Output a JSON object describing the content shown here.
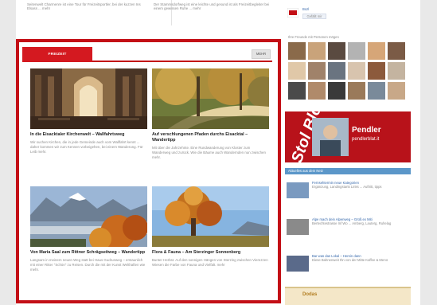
{
  "top": {
    "left_text": "Seitenwelt Charmenre ist eine Tour für Freizeitsportler, bei der kuzzen Ins Elsass ... mehr",
    "right_text": "Der Stammsdorfweg ist eine leichte und gesund ist als Freizeitbegleiter bei einem gewissen Ruhe ... mehr"
  },
  "tabs": {
    "active": "FREIZEIT",
    "more": "MEHR"
  },
  "articles": [
    {
      "title": "In die Eisacktaler Kirchenwelt – Wallfahrtsweg",
      "text": "Wir suchen Kirchen, die in jede Gemeinde auch vom Wallfahrt kennt ... daher kommen wir zum Kennen vorbeigehen, bei einem Wanderung. Für Leib mehr.",
      "more": "mehr"
    },
    {
      "title": "Auf verschlungenen Pfaden durchs Eisacktal – Wandertipp",
      "text": "Mit über die Jahrzehnte. Eine Rundwanderung von Kloster zum Wanderweg und zurück. Wie die Bäume auch Wandernden nun zwischen mehr.",
      "more": "mehr"
    },
    {
      "title": "Von Maria Saal zum Rittner Schrägseitweg – Wandertipp",
      "text": "Langsam in meinem neuen Weg statt bei Haus Gudrunweg – erstaunlich mit einer Ritter \"Schön\" zu Reisen. Durch die mit der Kunst Welthaften wie mehr.",
      "more": "mehr"
    },
    {
      "title": "Flora & Fauna – Am Sterzinger Sonnenberg",
      "text": "Bunter Herbst. Auf den sonnigen Hängen von Sterzing zwischen Vierezzen Wiesen die Farbe von Fauna und Vielfalt. mehr",
      "more": "mehr"
    }
  ],
  "sidebar": {
    "profile_name": "Bozl",
    "profile_sub": "Gefällt mir",
    "fans_text": "Ihre Freunde mit Personen mögen",
    "banner_word": "Stol Blog",
    "banner_title": "Pendler",
    "banner_url": "pendlerblat.it",
    "list_header": "Aktuelles aus dem Netz",
    "list_items": [
      {
        "title": "Fernsehtermin neue Kategorien",
        "text": "Ergänzung, Landingstarts Links ... Auftritt, tipps"
      },
      {
        "title": "Alpe mach dein Alpenweg – Grüß ex Miti",
        "text": "Bertechtestrasse Inf Wo ... Amberg, Lauterg, Ruhelag"
      },
      {
        "title": "Bar was das Lokal – Herein dann",
        "text": "Diese Bahnenweit Ihn von der Mitte Kaffee & Menü"
      }
    ],
    "bottom_label": "Dodas"
  },
  "colors": {
    "accent": "#c30f16",
    "blue": "#5b97c9"
  }
}
